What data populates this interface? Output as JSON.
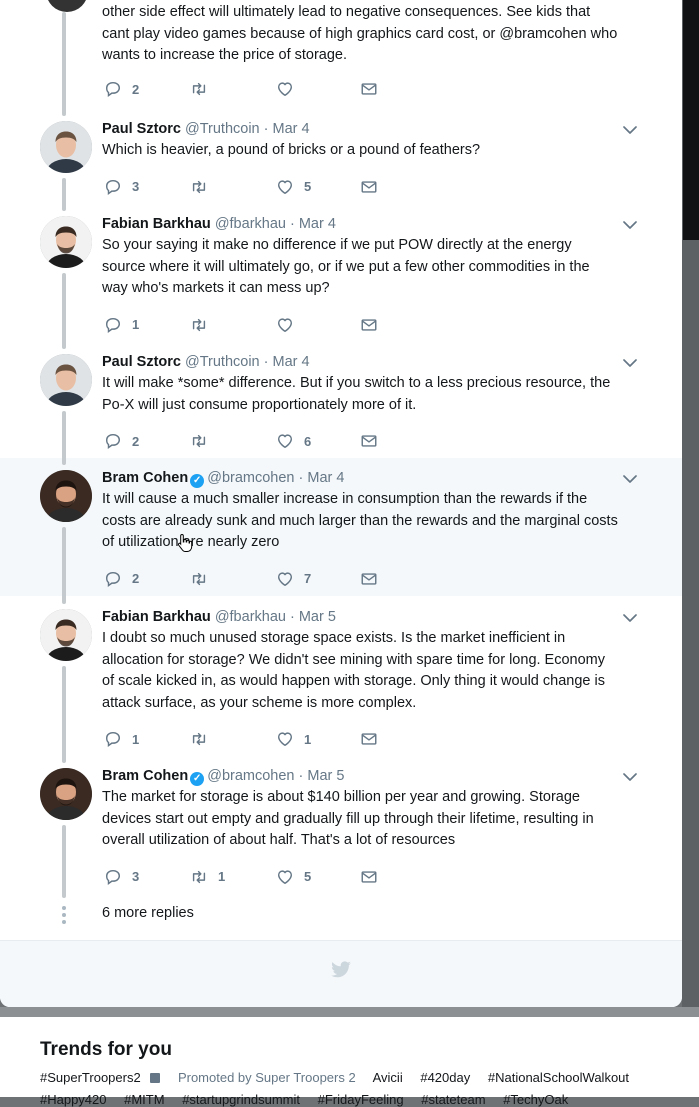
{
  "top_tweet": {
    "text_lines": [
      "other side effect will ultimately lead to negative consequences. See kids that",
      "cant play video games because of high graphics card cost, or @bramcohen who",
      "wants to increase the price of storage."
    ],
    "replies": "2",
    "retweets": "",
    "likes": ""
  },
  "tweets": [
    {
      "name": "Paul Sztorc",
      "handle": "@Truthcoin",
      "date": "· Mar 4",
      "verified": false,
      "lines": [
        "Which is heavier, a pound of bricks or a pound of feathers?"
      ],
      "replies": "3",
      "retweets": "",
      "likes": "5"
    },
    {
      "name": "Fabian Barkhau",
      "handle": "@fbarkhau",
      "date": "· Mar 4",
      "verified": false,
      "lines": [
        "So your saying it make no difference if we put POW directly at the energy",
        "source where it will ultimately go, or if we put a few other commodities in the",
        "way who's markets it can mess up?"
      ],
      "replies": "1",
      "retweets": "",
      "likes": ""
    },
    {
      "name": "Paul Sztorc",
      "handle": "@Truthcoin",
      "date": "· Mar 4",
      "verified": false,
      "lines": [
        "It will make *some* difference. But if you switch to a less precious resource, the",
        "Po-X will just consume proportionately more of it."
      ],
      "replies": "2",
      "retweets": "",
      "likes": "6"
    },
    {
      "name": "Bram Cohen",
      "handle": "@bramcohen",
      "date": "· Mar 4",
      "verified": true,
      "lines": [
        "It will cause a much smaller increase in consumption than the rewards if the",
        "costs are already sunk and much larger than the rewards and the marginal costs",
        "of utilization are nearly zero"
      ],
      "replies": "2",
      "retweets": "",
      "likes": "7"
    },
    {
      "name": "Fabian Barkhau",
      "handle": "@fbarkhau",
      "date": "· Mar 5",
      "verified": false,
      "lines": [
        "I doubt so much unused storage space exists. Is the market inefficient in",
        "allocation for storage? We didn't see mining with spare time for long. Economy",
        "of scale kicked in, as would happen with storage. Only thing it would change is",
        "attack surface, as your scheme is more complex."
      ],
      "replies": "1",
      "retweets": "",
      "likes": "1"
    },
    {
      "name": "Bram Cohen",
      "handle": "@bramcohen",
      "date": "· Mar 5",
      "verified": true,
      "lines": [
        "The market for storage is about $140 billion per year and growing. Storage",
        "devices start out empty and gradually fill up through their lifetime, resulting in",
        "overall utilization of about half. That's a lot of resources"
      ],
      "replies": "3",
      "retweets": "1",
      "likes": "5"
    }
  ],
  "more_replies": "6 more replies",
  "trends": {
    "title": "Trends for you",
    "row1": [
      "#SuperTroopers2",
      "Promoted by Super Troopers 2",
      "Avicii",
      "#420day",
      "#NationalSchoolWalkout"
    ],
    "row2": [
      "#Happy420",
      "#MITM",
      "#startupgrindsummit",
      "#FridayFeeling",
      "#stateteam",
      "#TechyOak"
    ]
  },
  "icons": [
    "reply-icon",
    "retweet-icon",
    "like-icon",
    "message-icon",
    "chevron-down-icon",
    "twitter-bird-icon",
    "verified-icon"
  ],
  "colors": {
    "accent": "#1da1f2",
    "muted": "#657786",
    "thread": "#c4c9cd",
    "highlight": "#f5f8fa"
  }
}
